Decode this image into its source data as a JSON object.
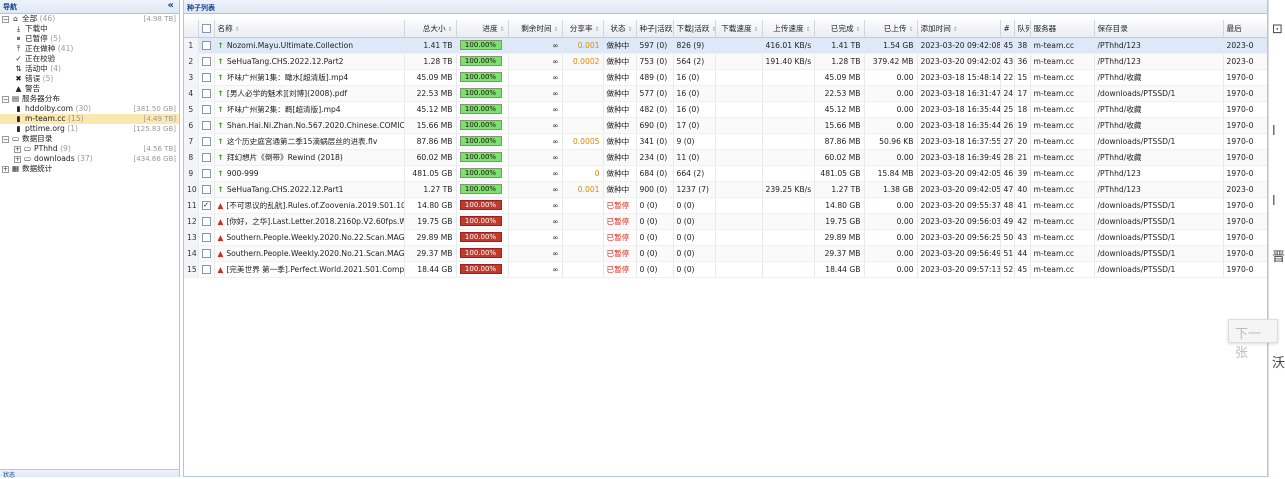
{
  "nav": {
    "title": "导航",
    "collapse": "«",
    "tree": [
      {
        "label": "全部",
        "count": "(46)",
        "size": "[4.98 TB]",
        "icon": "home-icon",
        "glyph": "⌂",
        "indent": 0,
        "exp": "−"
      },
      {
        "label": "下载中",
        "count": "",
        "icon": "download-icon",
        "glyph": "⤓",
        "indent": 1
      },
      {
        "label": "已暂停",
        "count": "(5)",
        "icon": "pause-icon",
        "glyph": "⏸",
        "indent": 1
      },
      {
        "label": "正在做种",
        "count": "(41)",
        "icon": "seeding-icon",
        "glyph": "⤒",
        "indent": 1
      },
      {
        "label": "正在校验",
        "count": "",
        "icon": "check-icon",
        "glyph": "✓",
        "indent": 1
      },
      {
        "label": "活动中",
        "count": "(4)",
        "icon": "active-icon",
        "glyph": "⇅",
        "indent": 1
      },
      {
        "label": "错误",
        "count": "(5)",
        "icon": "error-icon",
        "glyph": "✖",
        "indent": 1
      },
      {
        "label": "警告",
        "count": "",
        "icon": "warning-icon",
        "glyph": "▲",
        "indent": 1
      },
      {
        "label": "服务器分布",
        "count": "",
        "icon": "server-group-icon",
        "glyph": "▤",
        "indent": 0,
        "exp": "−"
      },
      {
        "label": "hddolby.com",
        "count": "(30)",
        "size": "[381.50 GB]",
        "icon": "server-icon",
        "glyph": "▮",
        "indent": 1
      },
      {
        "label": "m-team.cc",
        "count": "(15)",
        "size": "[4.49 TB]",
        "icon": "server-icon",
        "glyph": "▮",
        "indent": 1,
        "sel": true
      },
      {
        "label": "pttime.org",
        "count": "(1)",
        "size": "[125.83 GB]",
        "icon": "server-icon",
        "glyph": "▮",
        "indent": 1
      },
      {
        "label": "数据目录",
        "count": "",
        "icon": "folder-icon",
        "glyph": "▭",
        "indent": 0,
        "exp": "−"
      },
      {
        "label": "PThhd",
        "count": "(9)",
        "size": "[4.56 TB]",
        "icon": "folder-icon",
        "glyph": "▭",
        "indent": 1,
        "exp": "+"
      },
      {
        "label": "downloads",
        "count": "(37)",
        "size": "[434.66 GB]",
        "icon": "folder-icon",
        "glyph": "▭",
        "indent": 1,
        "exp": "+"
      },
      {
        "label": "数据统计",
        "count": "",
        "icon": "stats-icon",
        "glyph": "▦",
        "indent": 0,
        "exp": "+"
      }
    ],
    "footer": "状态"
  },
  "main": {
    "title": "种子列表"
  },
  "columns": [
    "",
    "",
    "名称",
    "总大小",
    "进度",
    "剩余时间",
    "分享率",
    "状态",
    "种子|活跃",
    "下载|活跃",
    "下载速度",
    "上传速度",
    "已完成",
    "已上传",
    "添加时间",
    "#",
    "队列",
    "服务器",
    "保存目录",
    "最后"
  ],
  "rows": [
    {
      "i": "1",
      "ok": true,
      "name": "Nozomi.Mayu.Ultimate.Collection",
      "size": "1.41 TB",
      "prog": "100.00%",
      "eta": "∞",
      "ratio": "0.001",
      "state": "做种中",
      "seed": "597 (0)",
      "peer": "826 (9)",
      "dl": "",
      "ul": "416.01 KB/s",
      "done": "1.41 TB",
      "up": "1.54 GB",
      "added": "2023-03-20 09:42:08",
      "n": "45",
      "q": "38",
      "srv": "m-team.cc",
      "dir": "/PThhd/123",
      "last": "2023-0",
      "sel": true
    },
    {
      "i": "2",
      "ok": true,
      "name": "SeHuaTang.CHS.2022.12.Part2",
      "size": "1.28 TB",
      "prog": "100.00%",
      "eta": "∞",
      "ratio": "0.0002",
      "state": "做种中",
      "seed": "753 (0)",
      "peer": "564 (2)",
      "dl": "",
      "ul": "191.40 KB/s",
      "done": "1.28 TB",
      "up": "379.42 MB",
      "added": "2023-03-20 09:42:02",
      "n": "43",
      "q": "36",
      "srv": "m-team.cc",
      "dir": "/PThhd/123",
      "last": "2023-0"
    },
    {
      "i": "3",
      "ok": true,
      "name": "坏味广州第1集：瞰水[超清版].mp4",
      "size": "45.09 MB",
      "prog": "100.00%",
      "eta": "∞",
      "ratio": "",
      "state": "做种中",
      "seed": "489 (0)",
      "peer": "16 (0)",
      "dl": "",
      "ul": "",
      "done": "45.09 MB",
      "up": "0.00",
      "added": "2023-03-18 15:48:14",
      "n": "22",
      "q": "15",
      "srv": "m-team.cc",
      "dir": "/PThhd/收藏",
      "last": "1970-0"
    },
    {
      "i": "4",
      "ok": true,
      "name": "[男人必学的魅术][刘博](2008).pdf",
      "size": "22.53 MB",
      "prog": "100.00%",
      "eta": "∞",
      "ratio": "",
      "state": "做种中",
      "seed": "577 (0)",
      "peer": "16 (0)",
      "dl": "",
      "ul": "",
      "done": "22.53 MB",
      "up": "0.00",
      "added": "2023-03-18 16:31:47",
      "n": "24",
      "q": "17",
      "srv": "m-team.cc",
      "dir": "/downloads/PTSSD/1",
      "last": "1970-0"
    },
    {
      "i": "5",
      "ok": true,
      "name": "坏味广州第2集：羁[超清版].mp4",
      "size": "45.12 MB",
      "prog": "100.00%",
      "eta": "∞",
      "ratio": "",
      "state": "做种中",
      "seed": "482 (0)",
      "peer": "16 (0)",
      "dl": "",
      "ul": "",
      "done": "45.12 MB",
      "up": "0.00",
      "added": "2023-03-18 16:35:44",
      "n": "25",
      "q": "18",
      "srv": "m-team.cc",
      "dir": "/PThhd/收藏",
      "last": "1970-0"
    },
    {
      "i": "6",
      "ok": true,
      "name": "Shan.Hai.Ni.Zhan.No.567.2020.Chinese.COMIC.eBook",
      "size": "15.66 MB",
      "prog": "100.00%",
      "eta": "∞",
      "ratio": "",
      "state": "做种中",
      "seed": "690 (0)",
      "peer": "17 (0)",
      "dl": "",
      "ul": "",
      "done": "15.66 MB",
      "up": "0.00",
      "added": "2023-03-18 16:35:44",
      "n": "26",
      "q": "19",
      "srv": "m-team.cc",
      "dir": "/PThhd/收藏",
      "last": "1970-0"
    },
    {
      "i": "7",
      "ok": true,
      "name": "这个历史庭宫通第二季15滴蜗层丝的进表.flv",
      "size": "87.86 MB",
      "prog": "100.00%",
      "eta": "∞",
      "ratio": "0.0005",
      "state": "做种中",
      "seed": "341 (0)",
      "peer": "9 (0)",
      "dl": "",
      "ul": "",
      "done": "87.86 MB",
      "up": "50.96 KB",
      "added": "2023-03-18 16:37:55",
      "n": "27",
      "q": "20",
      "srv": "m-team.cc",
      "dir": "/downloads/PTSSD/1",
      "last": "1970-0"
    },
    {
      "i": "8",
      "ok": true,
      "name": "拜幻想片《倒带》Rewind (2018)",
      "size": "60.02 MB",
      "prog": "100.00%",
      "eta": "∞",
      "ratio": "",
      "state": "做种中",
      "seed": "234 (0)",
      "peer": "11 (0)",
      "dl": "",
      "ul": "",
      "done": "60.02 MB",
      "up": "0.00",
      "added": "2023-03-18 16:39:49",
      "n": "28",
      "q": "21",
      "srv": "m-team.cc",
      "dir": "/PThhd/收藏",
      "last": "1970-0"
    },
    {
      "i": "9",
      "ok": true,
      "name": "900-999",
      "size": "481.05 GB",
      "prog": "100.00%",
      "eta": "∞",
      "ratio": "0",
      "state": "做种中",
      "seed": "684 (0)",
      "peer": "664 (2)",
      "dl": "",
      "ul": "",
      "done": "481.05 GB",
      "up": "15.84 MB",
      "added": "2023-03-20 09:42:05",
      "n": "46",
      "q": "39",
      "srv": "m-team.cc",
      "dir": "/PThhd/123",
      "last": "1970-0"
    },
    {
      "i": "10",
      "ok": true,
      "name": "SeHuaTang.CHS.2022.12.Part1",
      "size": "1.27 TB",
      "prog": "100.00%",
      "eta": "∞",
      "ratio": "0.001",
      "state": "做种中",
      "seed": "900 (0)",
      "peer": "1237 (7)",
      "dl": "",
      "ul": "239.25 KB/s",
      "done": "1.27 TB",
      "up": "1.38 GB",
      "added": "2023-03-20 09:42:05",
      "n": "47",
      "q": "40",
      "srv": "m-team.cc",
      "dir": "/PThhd/123",
      "last": "2023-0"
    },
    {
      "i": "11",
      "ok": false,
      "checked": true,
      "name": "[不可思议的乱航].Rules.of.Zoovenia.2019.S01.1080p",
      "size": "14.80 GB",
      "prog": "100.00%",
      "eta": "∞",
      "ratio": "",
      "state": "已暂停",
      "seed": "0 (0)",
      "peer": "0 (0)",
      "dl": "",
      "ul": "",
      "done": "14.80 GB",
      "up": "0.00",
      "added": "2023-03-20 09:55:37",
      "n": "48",
      "q": "41",
      "srv": "m-team.cc",
      "dir": "/downloads/PTSSD/1",
      "last": "1970-0"
    },
    {
      "i": "12",
      "ok": false,
      "name": "[你好，之华].Last.Letter.2018.2160p.V2.60fps.WEB",
      "size": "19.75 GB",
      "prog": "100.00%",
      "eta": "∞",
      "ratio": "",
      "state": "已暂停",
      "seed": "0 (0)",
      "peer": "0 (0)",
      "dl": "",
      "ul": "",
      "done": "19.75 GB",
      "up": "0.00",
      "added": "2023-03-20 09:56:03",
      "n": "49",
      "q": "42",
      "srv": "m-team.cc",
      "dir": "/downloads/PTSSD/1",
      "last": "1970-0"
    },
    {
      "i": "13",
      "ok": false,
      "name": "Southern.People.Weekly.2020.No.22.Scan.MAGAZINE",
      "size": "29.89 MB",
      "prog": "100.00%",
      "eta": "∞",
      "ratio": "",
      "state": "已暂停",
      "seed": "0 (0)",
      "peer": "0 (0)",
      "dl": "",
      "ul": "",
      "done": "29.89 MB",
      "up": "0.00",
      "added": "2023-03-20 09:56:25",
      "n": "50",
      "q": "43",
      "srv": "m-team.cc",
      "dir": "/downloads/PTSSD/1",
      "last": "1970-0"
    },
    {
      "i": "14",
      "ok": false,
      "name": "Southern.People.Weekly.2020.No.21.Scan.MAGAZINE",
      "size": "29.37 MB",
      "prog": "100.00%",
      "eta": "∞",
      "ratio": "",
      "state": "已暂停",
      "seed": "0 (0)",
      "peer": "0 (0)",
      "dl": "",
      "ul": "",
      "done": "29.37 MB",
      "up": "0.00",
      "added": "2023-03-20 09:56:49",
      "n": "51",
      "q": "44",
      "srv": "m-team.cc",
      "dir": "/downloads/PTSSD/1",
      "last": "1970-0"
    },
    {
      "i": "15",
      "ok": false,
      "name": "[完美世界 第一季].Perfect.World.2021.S01.Complete",
      "size": "18.44 GB",
      "prog": "100.00%",
      "eta": "∞",
      "ratio": "",
      "state": "已暂停",
      "seed": "0 (0)",
      "peer": "0 (0)",
      "dl": "",
      "ul": "",
      "done": "18.44 GB",
      "up": "0.00",
      "added": "2023-03-20 09:57:13",
      "n": "52",
      "q": "45",
      "srv": "m-team.cc",
      "dir": "/downloads/PTSSD/1",
      "last": "1970-0"
    }
  ],
  "side": {
    "glyphs": [
      "⊡",
      "l",
      "l",
      "晋",
      "沃"
    ]
  },
  "next_btn": "下一张"
}
